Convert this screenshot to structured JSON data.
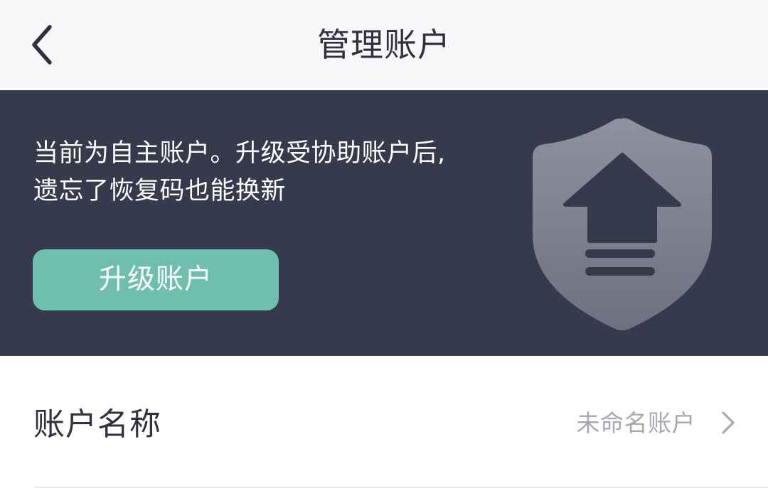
{
  "header": {
    "title": "管理账户"
  },
  "banner": {
    "line1": "当前为自主账户。升级受协助账户后,",
    "line2": "遗忘了恢复码也能换新",
    "button_label": "升级账户",
    "background": "#363a4d",
    "button_color": "#6fbfae"
  },
  "account": {
    "label": "账户名称",
    "value": "未命名账户"
  },
  "icons": {
    "back": "chevron-left-icon",
    "shield": "shield-upgrade-icon",
    "row_arrow": "chevron-right-icon"
  }
}
